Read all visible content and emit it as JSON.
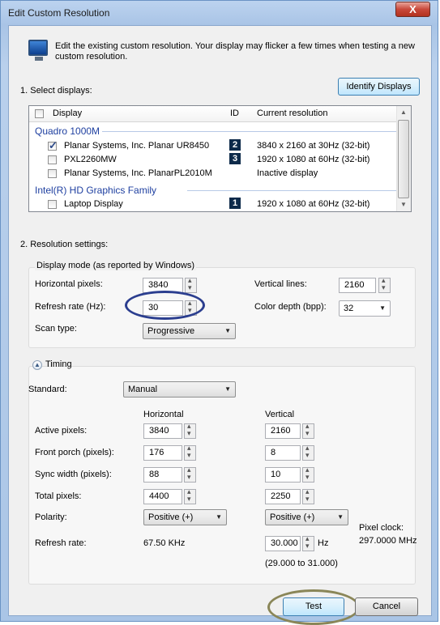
{
  "window": {
    "title": "Edit Custom Resolution",
    "close_label": "X"
  },
  "intro": "Edit the existing custom resolution. Your display may flicker a few times when testing a new custom resolution.",
  "select_displays": {
    "heading": "1. Select displays:",
    "identify_button": "Identify Displays",
    "columns": {
      "display": "Display",
      "id": "ID",
      "current": "Current resolution"
    },
    "groups": [
      {
        "name": "Quadro 1000M",
        "rows": [
          {
            "name": "Planar Systems, Inc. Planar UR8450",
            "checked": true,
            "id": "2",
            "resolution": "3840 x 2160 at 30Hz (32-bit)"
          },
          {
            "name": "PXL2260MW",
            "checked": false,
            "id": "3",
            "resolution": "1920 x 1080 at 60Hz (32-bit)"
          },
          {
            "name": "Planar Systems, Inc. PlanarPL2010M",
            "checked": false,
            "id": "",
            "resolution": "Inactive display"
          }
        ]
      },
      {
        "name": "Intel(R) HD Graphics Family",
        "rows": [
          {
            "name": "Laptop Display",
            "checked": false,
            "id": "1",
            "resolution": "1920 x 1080 at 60Hz (32-bit)"
          }
        ]
      }
    ]
  },
  "resolution_settings": {
    "heading": "2. Resolution settings:",
    "display_mode_label": "Display mode (as reported by Windows)",
    "horizontal_pixels": {
      "label": "Horizontal pixels:",
      "value": "3840"
    },
    "vertical_lines": {
      "label": "Vertical lines:",
      "value": "2160"
    },
    "refresh_rate": {
      "label": "Refresh rate (Hz):",
      "value": "30"
    },
    "color_depth": {
      "label": "Color depth (bpp):",
      "value": "32"
    },
    "scan_type": {
      "label": "Scan type:",
      "value": "Progressive"
    }
  },
  "timing": {
    "label": "Timing",
    "standard": {
      "label": "Standard:",
      "value": "Manual"
    },
    "col_horizontal": "Horizontal",
    "col_vertical": "Vertical",
    "rows": [
      {
        "label": "Active pixels:",
        "h": "3840",
        "v": "2160"
      },
      {
        "label": "Front porch (pixels):",
        "h": "176",
        "v": "8"
      },
      {
        "label": "Sync width (pixels):",
        "h": "88",
        "v": "10"
      },
      {
        "label": "Total pixels:",
        "h": "4400",
        "v": "2250"
      }
    ],
    "polarity": {
      "label": "Polarity:",
      "h": "Positive (+)",
      "v": "Positive (+)"
    },
    "refresh": {
      "label": "Refresh rate:",
      "h": "67.50 KHz",
      "v": "30.000",
      "unit": "Hz",
      "range": "(29.000 to 31.000)"
    },
    "pixel_clock": {
      "label": "Pixel clock:",
      "value": "297.0000 MHz"
    }
  },
  "buttons": {
    "test": "Test",
    "cancel": "Cancel"
  },
  "colors": {
    "highlight_ring_refresh": "#2b3e8f",
    "highlight_ring_test": "#8a8658",
    "titlebar": "#b9d0ec",
    "group_text": "#1e3fa0"
  }
}
